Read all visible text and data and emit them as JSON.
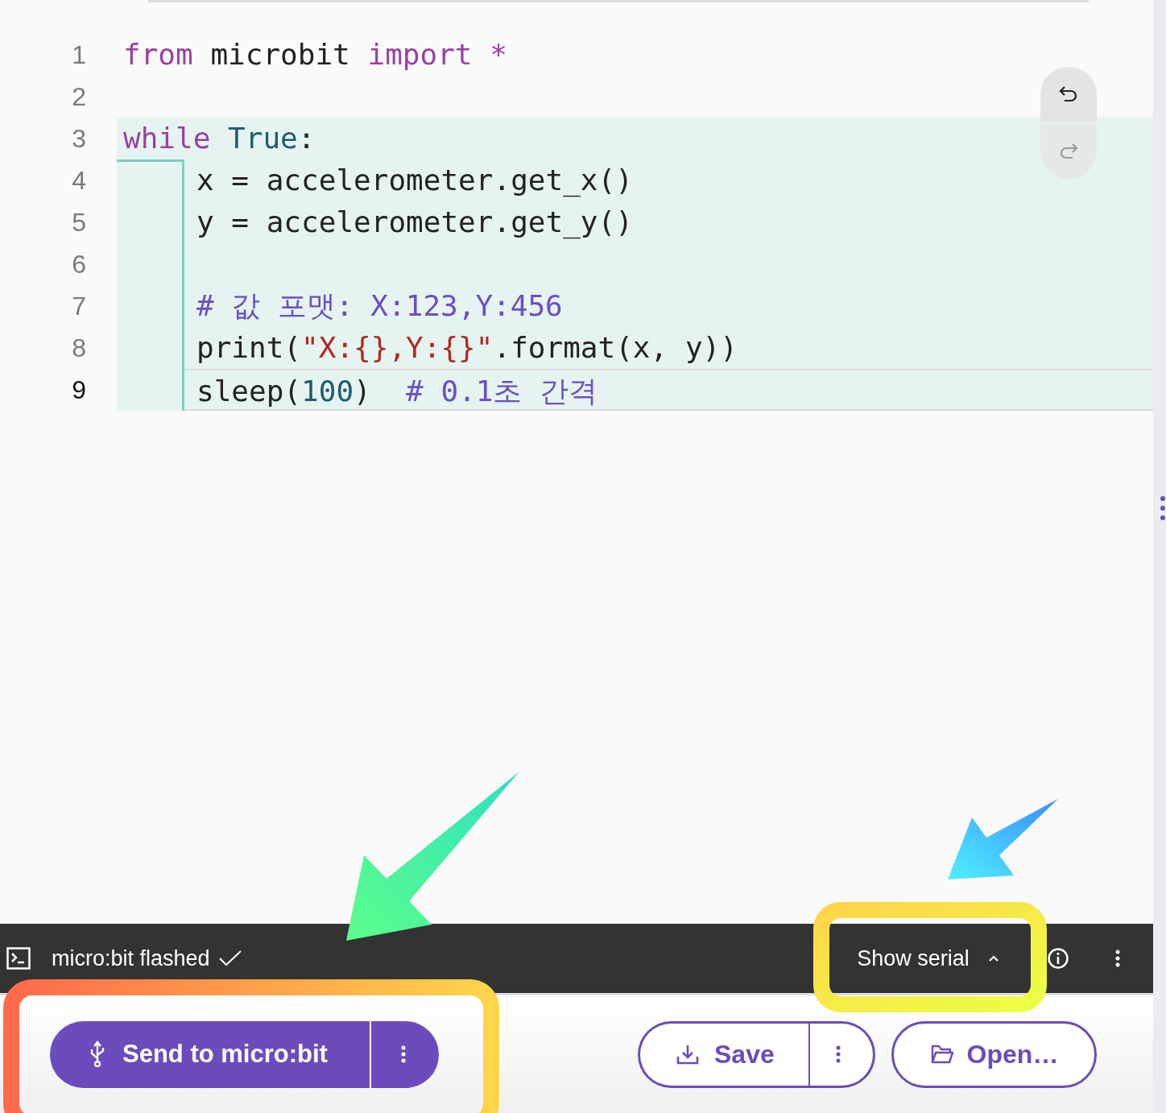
{
  "editor": {
    "lines": [
      {
        "number": "1",
        "selected": false,
        "tokens": [
          {
            "kind": "keyword",
            "text": "from"
          },
          {
            "kind": "plain",
            "text": " microbit "
          },
          {
            "kind": "keyword",
            "text": "import *"
          }
        ]
      },
      {
        "number": "2",
        "selected": false
      },
      {
        "number": "3",
        "selected": false,
        "tokens": [
          {
            "kind": "keyword",
            "text": "while"
          },
          {
            "kind": "constant",
            "text": " True"
          },
          {
            "kind": "plain",
            "text": ":"
          }
        ],
        "children": [
          {
            "number": "4",
            "selected": false,
            "tokens": [
              {
                "kind": "plain",
                "text": "x = accelerometer.get_x()"
              }
            ]
          },
          {
            "number": "5",
            "selected": false,
            "tokens": [
              {
                "kind": "plain",
                "text": "y = accelerometer.get_y()"
              }
            ]
          },
          {
            "number": "6",
            "selected": false
          },
          {
            "number": "7",
            "selected": false,
            "tokens": [
              {
                "kind": "comment",
                "text": "# 값 포맷: X:123,Y:456"
              }
            ]
          },
          {
            "number": "8",
            "selected": false,
            "tokens": [
              {
                "kind": "plain",
                "text": "print("
              },
              {
                "kind": "string",
                "text": "\"X:{},Y:{}\""
              },
              {
                "kind": "plain",
                "text": ".format(x, y))"
              }
            ]
          },
          {
            "number": "9",
            "selected": true,
            "tokens": [
              {
                "kind": "plain",
                "text": "sleep("
              },
              {
                "kind": "constant",
                "text": "100"
              },
              {
                "kind": "plain",
                "text": ")  "
              },
              {
                "kind": "comment",
                "text": "# 0.1초 간격"
              }
            ]
          }
        ]
      }
    ]
  },
  "history": {
    "undo": {
      "disabled": false
    },
    "redo": {
      "disabled": true
    }
  },
  "status_bar": {
    "message": "micro:bit flashed",
    "serial_button": {
      "label": "Show serial",
      "expanded": false
    }
  },
  "actions": {
    "send": {
      "label": "Send to micro:bit"
    },
    "save": {
      "label": "Save"
    },
    "open": {
      "label": "Open…"
    }
  }
}
